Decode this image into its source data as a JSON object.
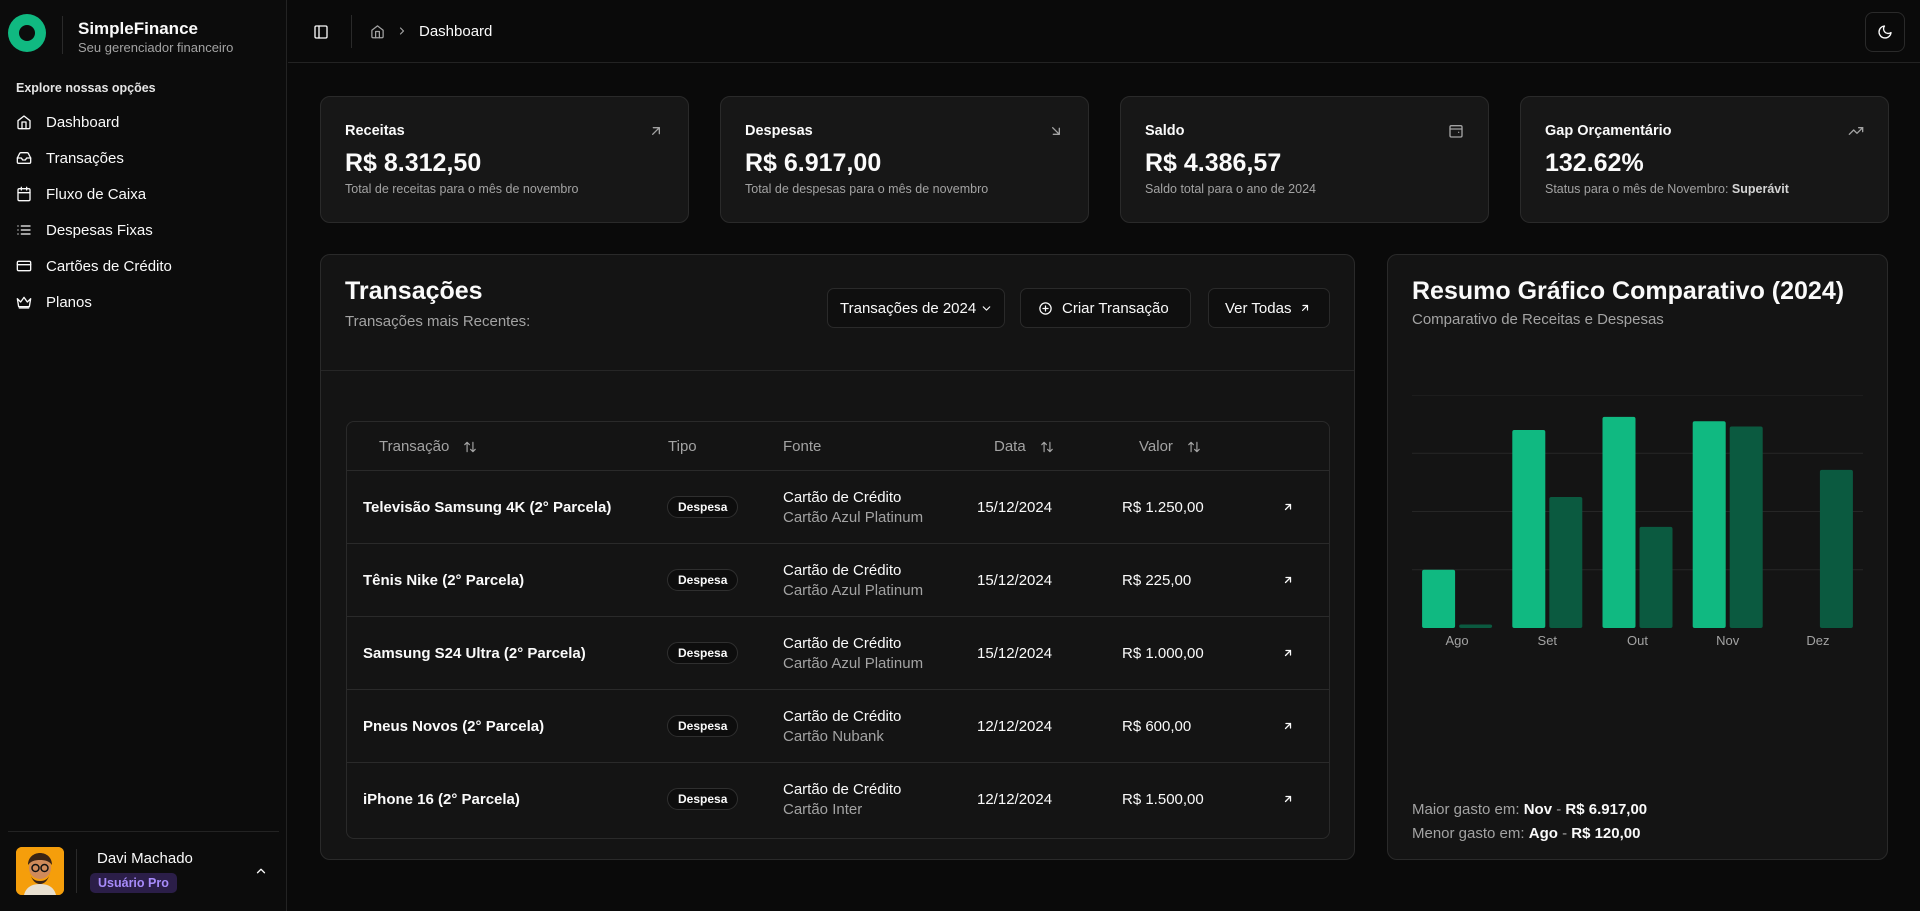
{
  "brand": {
    "name": "SimpleFinance",
    "tagline": "Seu gerenciador financeiro"
  },
  "sidebar": {
    "section_title": "Explore nossas opções",
    "items": [
      {
        "label": "Dashboard",
        "icon": "home-icon"
      },
      {
        "label": "Transações",
        "icon": "inbox-icon"
      },
      {
        "label": "Fluxo de Caixa",
        "icon": "calendar-icon"
      },
      {
        "label": "Despesas Fixas",
        "icon": "list-icon"
      },
      {
        "label": "Cartões de Crédito",
        "icon": "credit-card-icon"
      },
      {
        "label": "Planos",
        "icon": "crown-icon"
      }
    ]
  },
  "user": {
    "name": "Davi Machado",
    "badge": "Usuário Pro"
  },
  "header": {
    "breadcrumb": "Dashboard"
  },
  "stats": [
    {
      "title": "Receitas",
      "value": "R$ 8.312,50",
      "desc": "Total de receitas para o mês de novembro",
      "icon": "arrow-up-right-icon"
    },
    {
      "title": "Despesas",
      "value": "R$ 6.917,00",
      "desc": "Total de despesas para o mês de novembro",
      "icon": "arrow-down-right-icon"
    },
    {
      "title": "Saldo",
      "value": "R$ 4.386,57",
      "desc": "Saldo total para o ano de 2024",
      "icon": "wallet-icon"
    },
    {
      "title": "Gap Orçamentário",
      "value": "132.62%",
      "desc": "Status para o mês de Novembro:",
      "desc_strong": "Superávit",
      "icon": "trending-up-icon"
    }
  ],
  "transactions": {
    "title": "Transações",
    "subtitle": "Transações mais Recentes:",
    "filter_label": "Transações de 2024",
    "create_label": "Criar Transação",
    "view_all_label": "Ver Todas",
    "columns": {
      "name": "Transação",
      "type": "Tipo",
      "source": "Fonte",
      "date": "Data",
      "value": "Valor"
    },
    "rows": [
      {
        "name": "Televisão Samsung 4K (2° Parcela)",
        "type": "Despesa",
        "source": "Cartão de Crédito",
        "card": "Cartão Azul Platinum",
        "date": "15/12/2024",
        "value": "R$ 1.250,00"
      },
      {
        "name": "Tênis Nike (2° Parcela)",
        "type": "Despesa",
        "source": "Cartão de Crédito",
        "card": "Cartão Azul Platinum",
        "date": "15/12/2024",
        "value": "R$ 225,00"
      },
      {
        "name": "Samsung S24 Ultra (2° Parcela)",
        "type": "Despesa",
        "source": "Cartão de Crédito",
        "card": "Cartão Azul Platinum",
        "date": "15/12/2024",
        "value": "R$ 1.000,00"
      },
      {
        "name": "Pneus Novos (2° Parcela)",
        "type": "Despesa",
        "source": "Cartão de Crédito",
        "card": "Cartão Nubank",
        "date": "12/12/2024",
        "value": "R$ 600,00"
      },
      {
        "name": "iPhone 16 (2° Parcela)",
        "type": "Despesa",
        "source": "Cartão de Crédito",
        "card": "Cartão Inter",
        "date": "12/12/2024",
        "value": "R$ 1.500,00"
      }
    ]
  },
  "chart_panel": {
    "title": "Resumo Gráfico Comparativo (2024)",
    "subtitle": "Comparativo de Receitas e Despesas",
    "max_label": "Maior gasto em:",
    "max_month": "Nov",
    "max_value": "R$ 6.917,00",
    "min_label": "Menor gasto em:",
    "min_month": "Ago",
    "min_value": "R$ 120,00",
    "dash": "-"
  },
  "chart_data": {
    "type": "bar",
    "categories": [
      "Ago",
      "Set",
      "Out",
      "Nov",
      "Dez"
    ],
    "series": [
      {
        "values": [
          2000,
          6800,
          7250,
          7100,
          0
        ],
        "color": "#10b981"
      },
      {
        "values": [
          120,
          4500,
          3470,
          6917,
          5430
        ],
        "color": "#0b5a40"
      }
    ],
    "ylim": [
      0,
      8000
    ],
    "grid": true
  },
  "colors": {
    "accent": "#10b981",
    "accent_dark": "#0b5a40",
    "pro": "#a78bfa"
  }
}
